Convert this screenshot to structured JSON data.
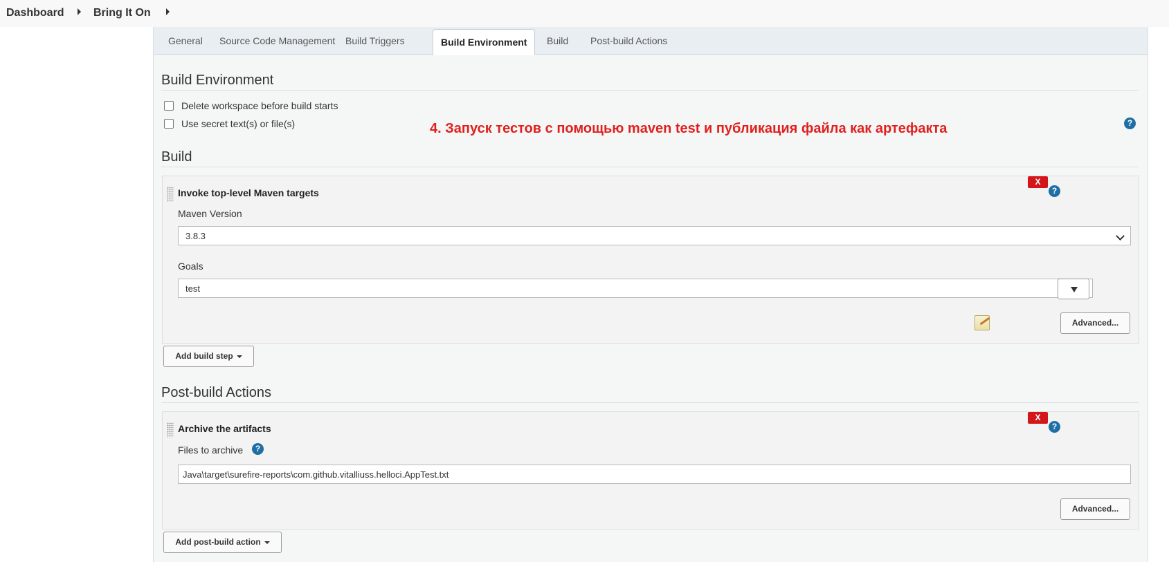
{
  "breadcrumb": {
    "dashboard": "Dashboard",
    "job": "Bring It On"
  },
  "tabs": [
    {
      "label": "General",
      "active": false
    },
    {
      "label": "Source Code Management",
      "active": false
    },
    {
      "label": "Build Triggers",
      "active": false
    },
    {
      "label": "Build Environment",
      "active": true
    },
    {
      "label": "Build",
      "active": false
    },
    {
      "label": "Post-build Actions",
      "active": false
    }
  ],
  "build_environment": {
    "title": "Build Environment",
    "options": [
      {
        "label": "Delete workspace before build starts",
        "checked": false
      },
      {
        "label": "Use secret text(s) or file(s)",
        "checked": false
      }
    ]
  },
  "annotation": "4. Запуск тестов с помощью maven test и публикация файла как артефакта",
  "build": {
    "title": "Build",
    "step": {
      "title": "Invoke top-level Maven targets",
      "delete_label": "X",
      "maven_version_label": "Maven Version",
      "maven_version_value": "3.8.3",
      "goals_label": "Goals",
      "goals_value": "test",
      "advanced_label": "Advanced..."
    },
    "add_button": "Add build step"
  },
  "post_build": {
    "title": "Post-build Actions",
    "action": {
      "title": "Archive the artifacts",
      "delete_label": "X",
      "files_label": "Files to archive",
      "files_value": "Java\\target\\surefire-reports\\com.github.vitalliuss.helloci.AppTest.txt",
      "advanced_label": "Advanced..."
    },
    "add_button": "Add post-build action"
  },
  "help_glyph": "?",
  "colors": {
    "delete": "#d3161a",
    "help": "#1f6fa5",
    "annotation": "#e0201e"
  }
}
